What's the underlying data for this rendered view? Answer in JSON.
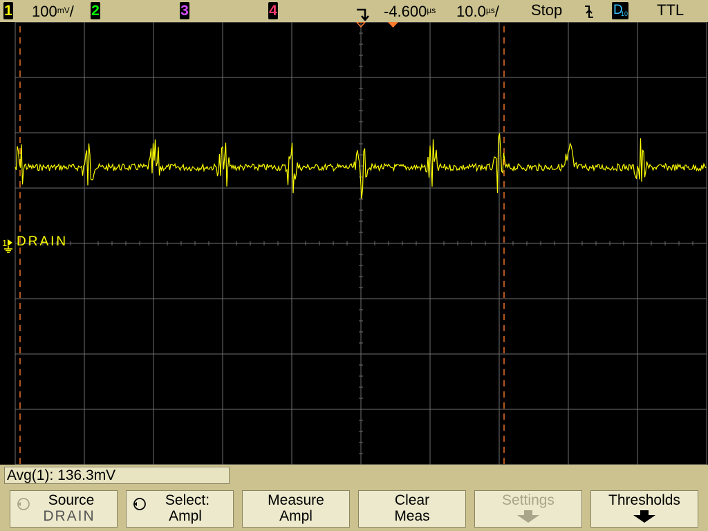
{
  "top": {
    "ch1": {
      "num": "1",
      "scale": "100",
      "unit": "mV",
      "slash": "/"
    },
    "ch2": {
      "num": "2"
    },
    "ch3": {
      "num": "3"
    },
    "ch4": {
      "num": "4"
    },
    "delay": {
      "value": "-4.600",
      "unit": "µs"
    },
    "timebase": {
      "value": "10.0",
      "unit": "µs",
      "slash": "/"
    },
    "run_state": "Stop",
    "trigger_source": "D",
    "trigger_source_sub": "10",
    "trigger_level": "TTL"
  },
  "channel_label": {
    "num": "1",
    "name": "DRAIN"
  },
  "measurement": {
    "text": "Avg(1): 136.3mV"
  },
  "softkeys": [
    {
      "line1": "Source",
      "line2": "DRAIN"
    },
    {
      "line1": "Select:",
      "line2": "Ampl"
    },
    {
      "line1": "Measure",
      "line2": "Ampl"
    },
    {
      "line1": "Clear",
      "line2": "Meas"
    },
    {
      "line1": "Settings"
    },
    {
      "line1": "Thresholds"
    }
  ],
  "colors": {
    "ch1": "#ffff00",
    "ch2": "#00ff00",
    "ch3": "#d34cff",
    "ch4": "#ff3a6e",
    "grid": "#6f6f6f",
    "cursor": "#ff7a2a",
    "bezel": "#cbc28f"
  }
}
